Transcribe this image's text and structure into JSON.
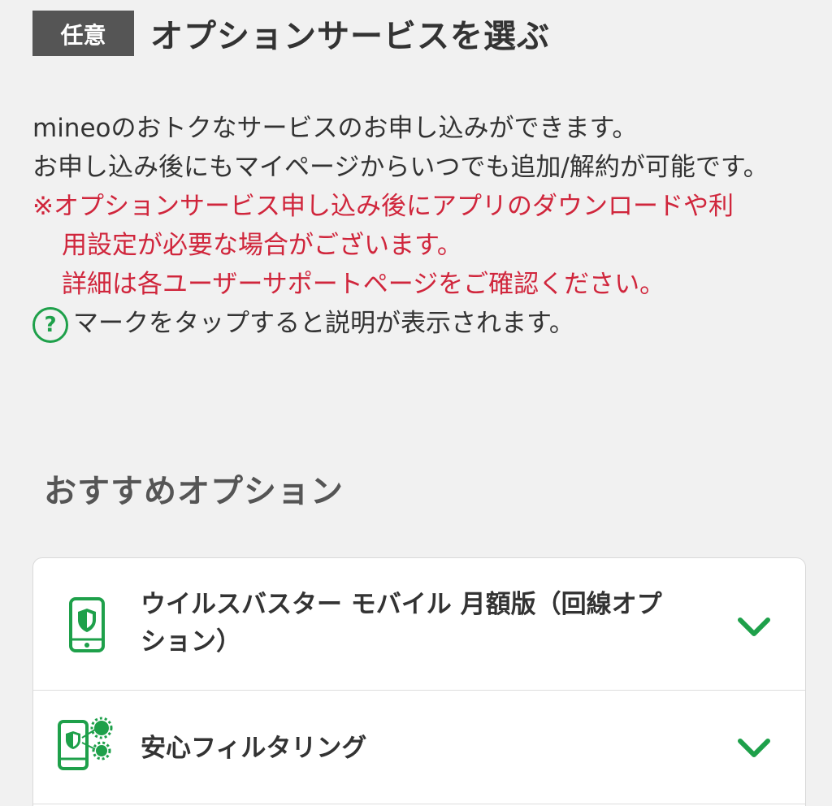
{
  "section": {
    "badge": "任意",
    "title": "オプションサービスを選ぶ"
  },
  "intro": {
    "line1": "mineoのおトクなサービスのお申し込みができます。",
    "line2": "お申し込み後にもマイページからいつでも追加/解約が可能です。",
    "warn_line1": "※オプションサービス申し込み後にアプリのダウンロードや利",
    "warn_line2": "用設定が必要な場合がございます。",
    "warn_line3": "詳細は各ユーザーサポートページをご確認ください。",
    "help_icon_glyph": "?",
    "help_text": "マークをタップすると説明が表示されます。"
  },
  "recommended": {
    "heading": "おすすめオプション",
    "options": [
      {
        "label": "ウイルスバスター モバイル 月額版（回線オプション）",
        "icon": "phone-shield-icon"
      },
      {
        "label": "安心フィルタリング",
        "icon": "phone-filter-icon"
      }
    ]
  },
  "colors": {
    "accent_green": "#1ea04a",
    "warning_red": "#d0263c",
    "badge_bg": "#555555"
  }
}
